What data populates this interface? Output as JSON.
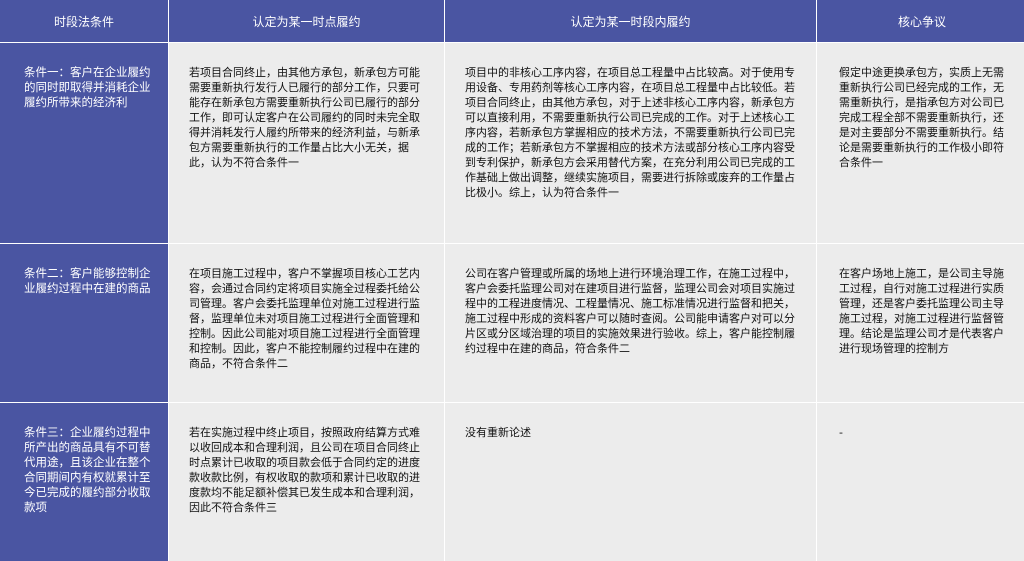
{
  "headers": [
    "时段法条件",
    "认定为某一时点履约",
    "认定为某一时段内履约",
    "核心争议"
  ],
  "rows": [
    {
      "condition": "条件一：客户在企业履约的同时即取得并消耗企业履约所带来的经济利",
      "point_in_time": "若项目合同终止，由其他方承包，新承包方可能需要重新执行发行人已履行的部分工作，只要可能存在新承包方需要重新执行公司已履行的部分工作，即可认定客户在公司履约的同时未完全取得并消耗发行人履约所带来的经济利益，与新承包方需要重新执行的工作量占比大小无关，据此，认为不符合条件一",
      "over_time": "项目中的非核心工序内容，在项目总工程量中占比较高。对于使用专用设备、专用药剂等核心工序内容，在项目总工程量中占比较低。若项目合同终止，由其他方承包，对于上述非核心工序内容，新承包方可以直接利用，不需要重新执行公司已完成的工作。对于上述核心工序内容，若新承包方掌握相应的技术方法，不需要重新执行公司已完成的工作；若新承包方不掌握相应的技术方法或部分核心工序内容受到专利保护，新承包方会采用替代方案，在充分利用公司已完成的工作基础上做出调整，继续实施项目，需要进行拆除或废弃的工作量占比极小。综上，认为符合条件一",
      "dispute": "假定中途更换承包方，实质上无需重新执行公司已经完成的工作，无需重新执行，是指承包方对公司已完成工程全部不需要重新执行，还是对主要部分不需要重新执行。结论是需要重新执行的工作极小即符合条件一"
    },
    {
      "condition": "条件二：客户能够控制企业履约过程中在建的商品",
      "point_in_time": "在项目施工过程中，客户不掌握项目核心工艺内容，会通过合同约定将项目实施全过程委托给公司管理。客户会委托监理单位对施工过程进行监督，监理单位未对项目施工过程进行全面管理和控制。因此公司能对项目施工过程进行全面管理和控制。因此，客户不能控制履约过程中在建的商品，不符合条件二",
      "over_time": "公司在客户管理或所属的场地上进行环境治理工作，在施工过程中，客户会委托监理公司对在建项目进行监督，监理公司会对项目实施过程中的工程进度情况、工程量情况、施工标准情况进行监督和把关，施工过程中形成的资料客户可以随时查阅。公司能申请客户对可以分片区或分区域治理的项目的实施效果进行验收。综上，客户能控制履约过程中在建的商品，符合条件二",
      "dispute": "在客户场地上施工，是公司主导施工过程，自行对施工过程进行实质管理，还是客户委托监理公司主导施工过程，对施工过程进行监督管理。结论是监理公司才是代表客户进行现场管理的控制方"
    },
    {
      "condition": "条件三：企业履约过程中所产出的商品具有不可替代用途，且该企业在整个合同期间内有权就累计至今已完成的履约部分收取款项",
      "point_in_time": "若在实施过程中终止项目，按照政府结算方式难以收回成本和合理利润，且公司在项目合同终止时点累计已收取的项目款会低于合同约定的进度款收款比例，有权收取的款项和累计已收取的进度款均不能足额补偿其已发生成本和合理利润，因此不符合条件三",
      "over_time": "没有重新论述",
      "dispute": "-"
    }
  ]
}
